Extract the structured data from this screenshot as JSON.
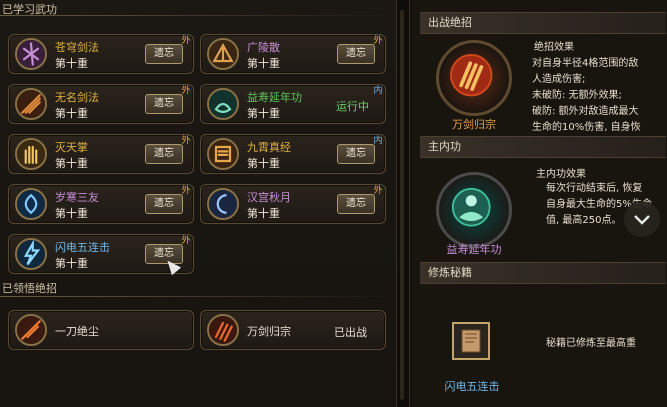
{
  "left": {
    "learned_title": "已学习武功",
    "ultimate_title": "已领悟绝招",
    "skills": [
      {
        "name": "苍穹剑法",
        "level": "第十重",
        "button": "遗忘",
        "tag": "外",
        "name_color": "gold",
        "icon": "sword-wheel-icon"
      },
      {
        "name": "广陵散",
        "level": "第十重",
        "button": "遗忘",
        "tag": "外",
        "name_color": "purple",
        "icon": "fan-icon"
      },
      {
        "name": "无名剑法",
        "level": "第十重",
        "button": "遗忘",
        "tag": "外",
        "name_color": "gold",
        "icon": "crossed-blades-icon"
      },
      {
        "name": "益寿延年功",
        "level": "第十重",
        "status": "运行中",
        "tag": "内",
        "name_color": "green",
        "icon": "lotus-icon"
      },
      {
        "name": "灭天掌",
        "level": "第十重",
        "button": "遗忘",
        "tag": "外",
        "name_color": "gold",
        "icon": "palm-icon"
      },
      {
        "name": "九霄真经",
        "level": "第十重",
        "button": "遗忘",
        "tag": "内",
        "name_color": "gold",
        "icon": "scroll-icon"
      },
      {
        "name": "岁寒三友",
        "level": "第十重",
        "button": "遗忘",
        "tag": "外",
        "name_color": "purple",
        "icon": "blue-swirl-icon"
      },
      {
        "name": "汉宫秋月",
        "level": "第十重",
        "button": "遗忘",
        "tag": "外",
        "name_color": "purple",
        "icon": "moon-icon"
      },
      {
        "name": "闪电五连击",
        "level": "第十重",
        "button": "遗忘",
        "tag": "外",
        "name_color": "blue",
        "icon": "lightning-icon"
      }
    ],
    "ultimates": [
      {
        "name": "一刀绝尘",
        "icon": "blade-slash-icon"
      },
      {
        "name": "万剑归宗",
        "status": "已出战",
        "icon": "claw-slash-icon"
      }
    ]
  },
  "right": {
    "battle_header": "出战绝招",
    "battle_skill_name": "万剑归宗",
    "battle_effect_title": "绝招效果",
    "battle_effect_lines": [
      "对自身半径4格范围的敌",
      "人造成伤害;",
      "未破防: 无额外效果;",
      "破防: 额外对敌造成最大",
      "生命的10%伤害, 自身恢"
    ],
    "inner_header": "主内功",
    "inner_skill_name": "益寿延年功",
    "inner_effect_title": "主内功效果",
    "inner_effect_lines": [
      "每次行动结束后, 恢复",
      "自身最大生命的5%生命",
      "值, 最高250点。"
    ],
    "manual_header": "修炼秘籍",
    "manual_book_name": "闪电五连击",
    "manual_text": "秘籍已修炼至最高重"
  },
  "colors": {
    "gold": "#e0b040",
    "purple": "#c98fd9",
    "blue": "#6fb7ea",
    "green": "#60c45a",
    "running": "#6fd16a"
  }
}
